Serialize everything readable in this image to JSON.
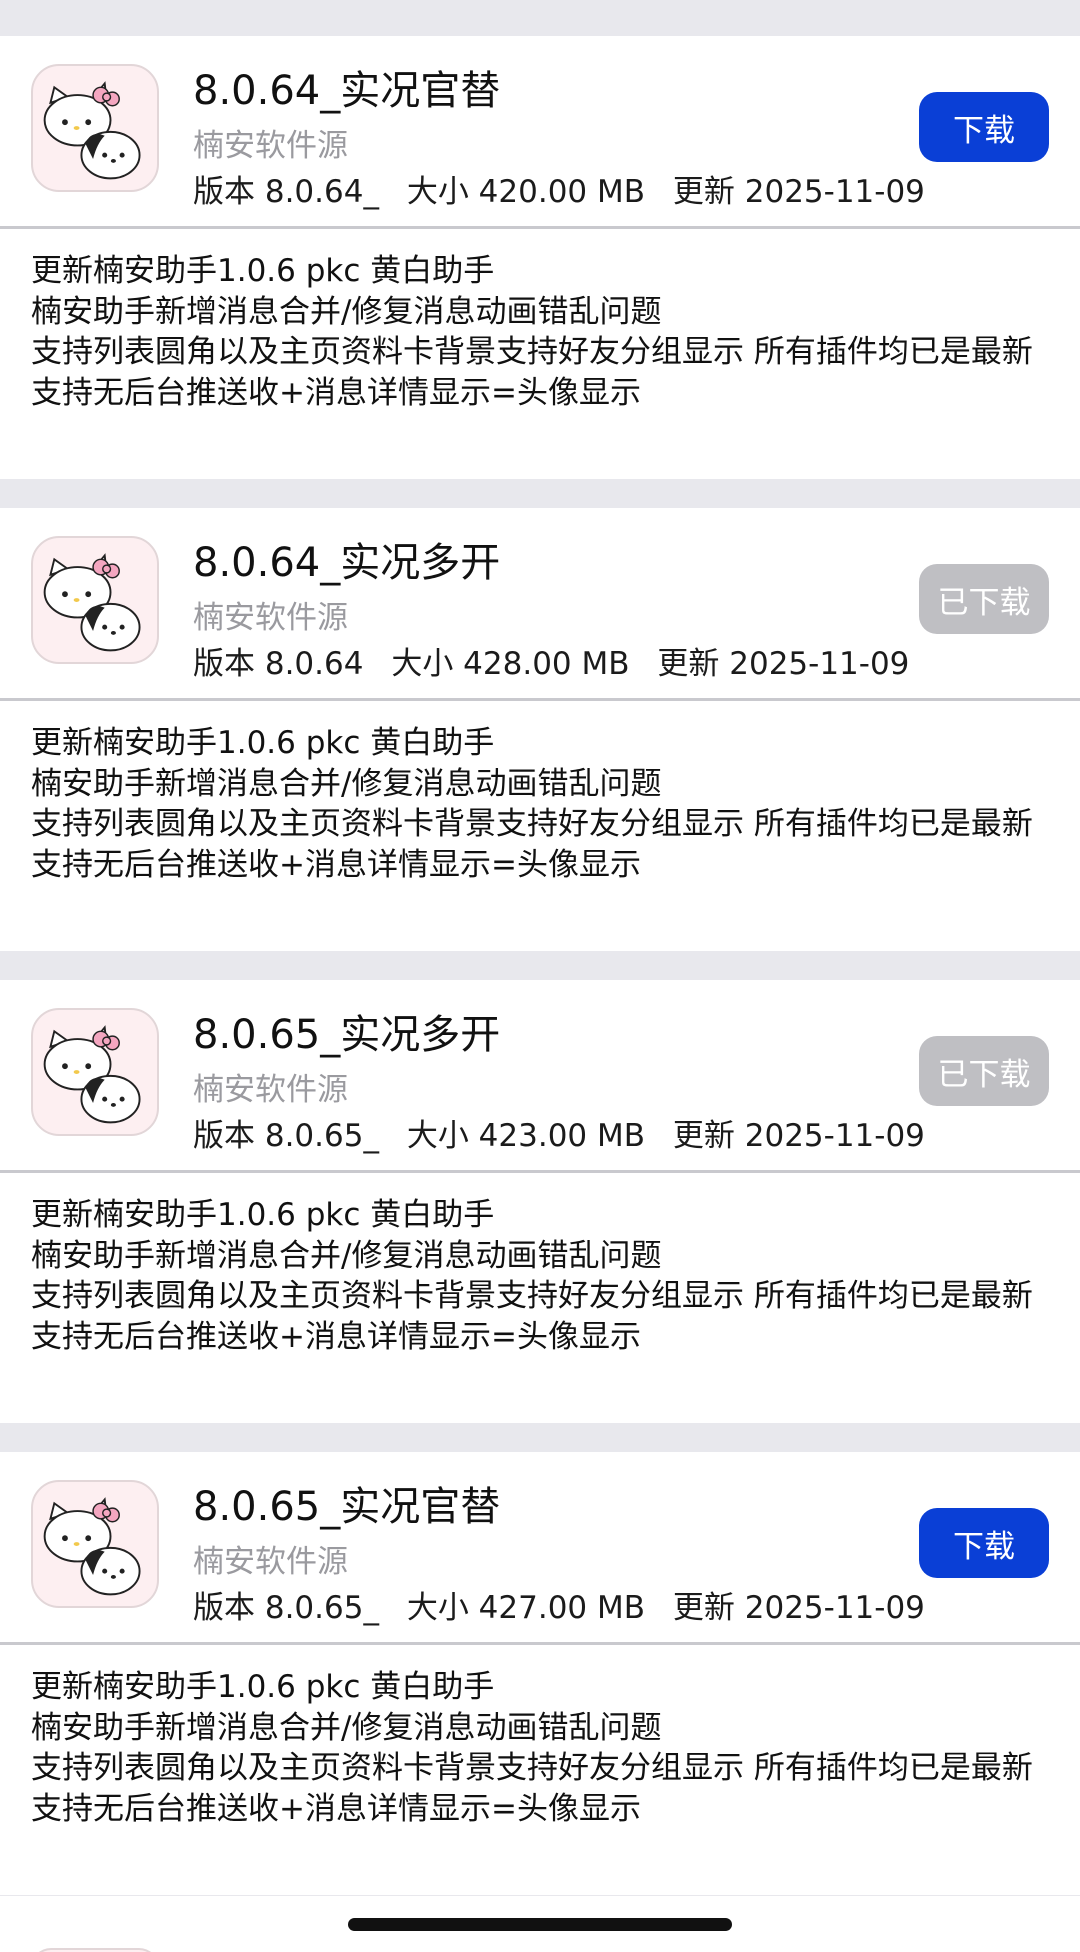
{
  "cards": [
    {
      "title": "8.0.64_实况官替",
      "source": "楠安软件源",
      "version": "版本 8.0.64_",
      "size": "大小 420.00 MB",
      "updated": "更新 2025-11-09",
      "button": "下载",
      "state": "download",
      "notes": [
        "更新楠安助手1.0.6 pkc 黄白助手",
        "楠安助手新增消息合并/修复消息动画错乱问题",
        "支持列表圆角以及主页资料卡背景支持好友分组显示 所有插件均已是最新",
        "支持无后台推送收+消息详情显示=头像显示"
      ]
    },
    {
      "title": "8.0.64_实况多开",
      "source": "楠安软件源",
      "version": "版本 8.0.64",
      "size": "大小 428.00 MB",
      "updated": "更新 2025-11-09",
      "button": "已下载",
      "state": "downloaded",
      "notes": [
        "更新楠安助手1.0.6 pkc 黄白助手",
        "楠安助手新增消息合并/修复消息动画错乱问题",
        "支持列表圆角以及主页资料卡背景支持好友分组显示 所有插件均已是最新",
        "支持无后台推送收+消息详情显示=头像显示"
      ]
    },
    {
      "title": "8.0.65_实况多开",
      "source": "楠安软件源",
      "version": "版本 8.0.65_",
      "size": "大小 423.00 MB",
      "updated": "更新 2025-11-09",
      "button": "已下载",
      "state": "downloaded",
      "notes": [
        "更新楠安助手1.0.6 pkc 黄白助手",
        "楠安助手新增消息合并/修复消息动画错乱问题",
        "支持列表圆角以及主页资料卡背景支持好友分组显示 所有插件均已是最新",
        "支持无后台推送收+消息详情显示=头像显示"
      ]
    },
    {
      "title": "8.0.65_实况官替",
      "source": "楠安软件源",
      "version": "版本 8.0.65_",
      "size": "大小 427.00 MB",
      "updated": "更新 2025-11-09",
      "button": "下载",
      "state": "download",
      "notes": [
        "更新楠安助手1.0.6 pkc 黄白助手",
        "楠安助手新增消息合并/修复消息动画错乱问题",
        "支持列表圆角以及主页资料卡背景支持好友分组显示 所有插件均已是最新",
        "支持无后台推送收+消息详情显示=头像显示"
      ]
    }
  ],
  "colors": {
    "primary_button": "#0a3fd6",
    "disabled_button": "#bfbfc3",
    "secondary_text": "#9a9a9f",
    "separator": "#e8e8ed"
  },
  "icon_name": "hello-kitty-pochacco-app-icon"
}
